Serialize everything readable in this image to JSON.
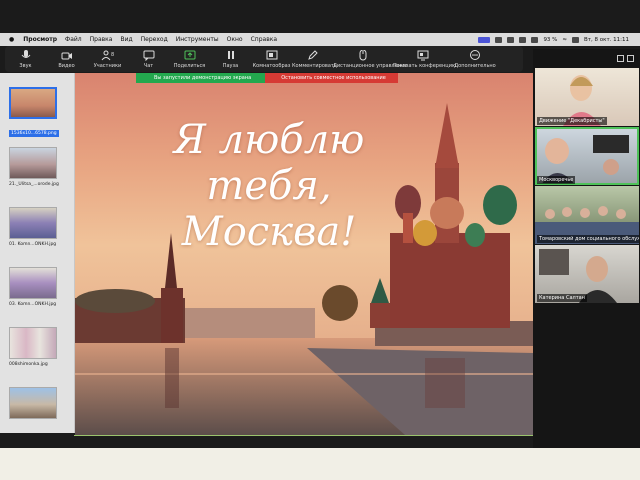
{
  "menubar": {
    "app": "Просмотр",
    "items": [
      "Файл",
      "Правка",
      "Вид",
      "Переход",
      "Инструменты",
      "Окно",
      "Справка"
    ],
    "battery": "93 %",
    "datetime": "Вт, 8 окт.  11:11"
  },
  "toolbar": {
    "items": [
      {
        "label": "Звук",
        "icon": "microphone-icon"
      },
      {
        "label": "Видео",
        "icon": "camera-icon"
      },
      {
        "label": "Участники",
        "icon": "participants-icon",
        "count": "8"
      },
      {
        "label": "Чат",
        "icon": "chat-icon"
      },
      {
        "label": "Поделиться",
        "icon": "share-screen-icon"
      },
      {
        "label": "Пауза",
        "icon": "pause-icon"
      },
      {
        "label": "Комнатообраз",
        "icon": "rooms-icon"
      },
      {
        "label": "Комментировать",
        "icon": "pencil-icon"
      },
      {
        "label": "Дистанционное управление",
        "icon": "mouse-icon"
      },
      {
        "label": "Показать конференцию",
        "icon": "monitor-icon"
      },
      {
        "label": "Дополнительно",
        "icon": "more-icon"
      }
    ]
  },
  "share": {
    "status": "Вы запустили демонстрацию экрана",
    "stop": "Остановить совместное использование"
  },
  "thumbnails": [
    {
      "label": "1536x10...6578.png",
      "selected": true
    },
    {
      "label": "21._Ulitsa_...orode.jpg",
      "selected": false
    },
    {
      "label": "01. Komn...ONKH.jpg",
      "selected": false
    },
    {
      "label": "03. Komn...ONKH.jpg",
      "selected": false
    },
    {
      "label": "008shimonka.jpg",
      "selected": false
    },
    {
      "label": "",
      "selected": false
    }
  ],
  "slide": {
    "line1": "Я люблю тебя,",
    "line2": "Москва!"
  },
  "participants": [
    {
      "name": "Движение \"Декабристы\""
    },
    {
      "name": "Москворечье"
    },
    {
      "name": "Томаровский дом социального обслуж..."
    },
    {
      "name": "Катерина Салтан"
    }
  ],
  "colors": {
    "share_ok": "#23a84e",
    "share_stop": "#d63a34",
    "selection": "#2d6fe8",
    "active_speaker": "#4fc25a"
  }
}
